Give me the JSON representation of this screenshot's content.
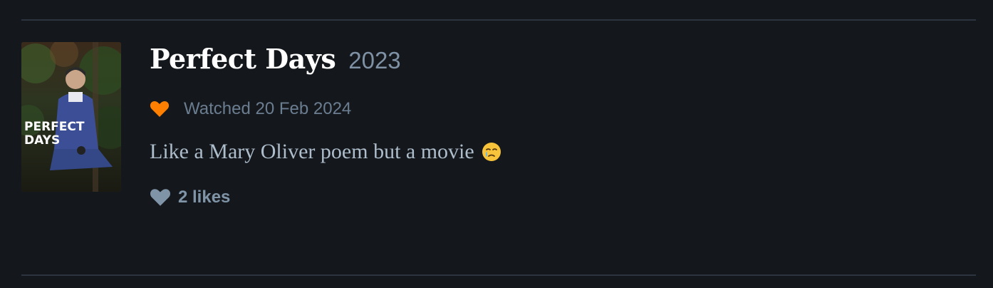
{
  "film": {
    "title": "Perfect Days",
    "year": "2023",
    "poster_text_line1": "PERFECT",
    "poster_text_line2": "DAYS"
  },
  "entry": {
    "liked": true,
    "liked_icon": "heart-icon",
    "watched_text": "Watched 20 Feb 2024",
    "review": "Like a Mary Oliver poem but a movie",
    "review_emoji": "face-holding-back-tears"
  },
  "likes": {
    "icon": "heart-icon",
    "label": "2 likes"
  },
  "colors": {
    "background": "#14181c",
    "liked_heart": "#ff8000",
    "likes_heart": "#8094a8",
    "title": "#ffffff",
    "muted": "#7f91a5"
  }
}
